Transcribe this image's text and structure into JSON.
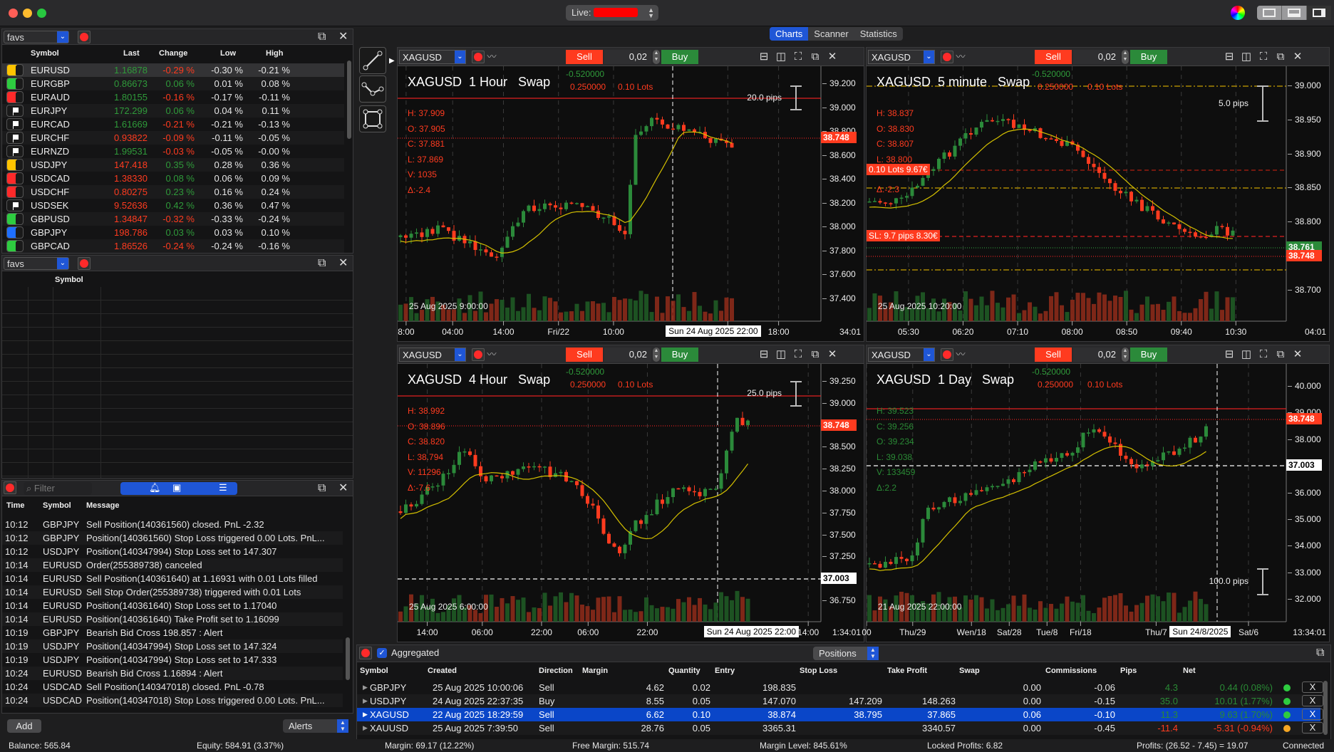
{
  "titlebar": {
    "account_label": "Live:",
    "colors": {
      "red": "#ff5f57",
      "yellow": "#febc2e",
      "green": "#28c840"
    }
  },
  "tabs": [
    {
      "label": "Charts",
      "active": true
    },
    {
      "label": "Scanner"
    },
    {
      "label": "Statistics"
    }
  ],
  "watchlist": {
    "list_name": "favs",
    "columns": [
      "Symbol",
      "Last",
      "Change",
      "Low",
      "High"
    ],
    "rows": [
      {
        "flag": "#ffc400",
        "symbol": "EURUSD",
        "last": "1.16878",
        "last_dir": "up",
        "change": "-0.29 %",
        "change_dir": "down",
        "low": "-0.30 %",
        "high": "-0.21 %"
      },
      {
        "flag": "#2ecc40",
        "symbol": "EURGBP",
        "last": "0.86673",
        "last_dir": "up",
        "change": "0.06 %",
        "change_dir": "up",
        "low": "0.01 %",
        "high": "0.08 %"
      },
      {
        "flag": "#ff2a2a",
        "symbol": "EURAUD",
        "last": "1.80155",
        "last_dir": "up",
        "change": "-0.16 %",
        "change_dir": "down",
        "low": "-0.17 %",
        "high": "-0.11 %"
      },
      {
        "flag": "white",
        "symbol": "EURJPY",
        "last": "172.299",
        "last_dir": "up",
        "change": "0.06 %",
        "change_dir": "up",
        "low": "0.04 %",
        "high": "0.11 %"
      },
      {
        "flag": "white",
        "symbol": "EURCAD",
        "last": "1.61669",
        "last_dir": "up",
        "change": "-0.21 %",
        "change_dir": "down",
        "low": "-0.21 %",
        "high": "-0.13 %"
      },
      {
        "flag": "white",
        "symbol": "EURCHF",
        "last": "0.93822",
        "last_dir": "down",
        "change": "-0.09 %",
        "change_dir": "down",
        "low": "-0.11 %",
        "high": "-0.05 %"
      },
      {
        "flag": "white",
        "symbol": "EURNZD",
        "last": "1.99531",
        "last_dir": "up",
        "change": "-0.03 %",
        "change_dir": "down",
        "low": "-0.05 %",
        "high": "-0.00 %"
      },
      {
        "flag": "#ffc400",
        "symbol": "USDJPY",
        "last": "147.418",
        "last_dir": "down",
        "change": "0.35 %",
        "change_dir": "up",
        "low": "0.28 %",
        "high": "0.36 %"
      },
      {
        "flag": "#ff2a2a",
        "symbol": "USDCAD",
        "last": "1.38330",
        "last_dir": "down",
        "change": "0.08 %",
        "change_dir": "up",
        "low": "0.06 %",
        "high": "0.09 %"
      },
      {
        "flag": "#ff2a2a",
        "symbol": "USDCHF",
        "last": "0.80275",
        "last_dir": "down",
        "change": "0.23 %",
        "change_dir": "up",
        "low": "0.16 %",
        "high": "0.24 %"
      },
      {
        "flag": "white",
        "symbol": "USDSEK",
        "last": "9.52636",
        "last_dir": "down",
        "change": "0.42 %",
        "change_dir": "up",
        "low": "0.36 %",
        "high": "0.47 %"
      },
      {
        "flag": "#2ecc40",
        "symbol": "GBPUSD",
        "last": "1.34847",
        "last_dir": "down",
        "change": "-0.32 %",
        "change_dir": "down",
        "low": "-0.33 %",
        "high": "-0.24 %"
      },
      {
        "flag": "#1f6fff",
        "symbol": "GBPJPY",
        "last": "198.786",
        "last_dir": "down",
        "change": "0.03 %",
        "change_dir": "up",
        "low": "0.03 %",
        "high": "0.10 %"
      },
      {
        "flag": "#2ecc40",
        "symbol": "GBPCAD",
        "last": "1.86526",
        "last_dir": "down",
        "change": "-0.24 %",
        "change_dir": "down",
        "low": "-0.24 %",
        "high": "-0.16 %"
      }
    ]
  },
  "watchlist2": {
    "list_name": "favs",
    "column": "Symbol"
  },
  "log": {
    "filter_placeholder": "Filter",
    "columns": [
      "Time",
      "Symbol",
      "Message"
    ],
    "rows": [
      [
        "10:12",
        "GBPJPY",
        "Sell Position(140361560) closed. PnL -2.32"
      ],
      [
        "10:12",
        "GBPJPY",
        "Position(140361560) Stop Loss triggered 0.00 Lots. PnL..."
      ],
      [
        "10:12",
        "USDJPY",
        "Position(140347994) Stop Loss set to 147.307"
      ],
      [
        "10:14",
        "EURUSD",
        "Order(255389738) canceled"
      ],
      [
        "10:14",
        "EURUSD",
        "Sell Position(140361640) at 1.16931 with 0.01 Lots filled"
      ],
      [
        "10:14",
        "EURUSD",
        "Sell  Stop Order(255389738) triggered with 0.01 Lots"
      ],
      [
        "10:14",
        "EURUSD",
        "Position(140361640) Stop Loss set to 1.17040"
      ],
      [
        "10:14",
        "EURUSD",
        "Position(140361640) Take Profit set to 1.16099"
      ],
      [
        "10:19",
        "GBPJPY",
        "Bearish Bid Cross 198.857 : Alert"
      ],
      [
        "10:19",
        "USDJPY",
        "Position(140347994) Stop Loss set to 147.324"
      ],
      [
        "10:19",
        "USDJPY",
        "Position(140347994) Stop Loss set to 147.333"
      ],
      [
        "10:24",
        "EURUSD",
        "Bearish Bid Cross 1.16894 : Alert"
      ],
      [
        "10:24",
        "USDCAD",
        "Sell Position(140347018) closed. PnL -0.78"
      ],
      [
        "10:24",
        "USDCAD",
        "Position(140347018) Stop Loss triggered 0.00 Lots. PnL..."
      ]
    ],
    "add_label": "Add",
    "mode_select": "Alerts"
  },
  "charts": [
    {
      "symbol": "XAGUSD",
      "qty": "0,02",
      "sell": "Sell",
      "buy": "Buy",
      "title": "XAGUSD  1 Hour   Swap",
      "swap_long": "-0.520000",
      "swap_short": "0.250000",
      "lots": "0.10 Lots",
      "ohlc": [
        "H: 37.909",
        "O: 37.905",
        "C: 37.881",
        "L: 37.869",
        "V: 1035",
        "Δ:-2.4"
      ],
      "ohlc_color": "red",
      "yticks": [
        "39.200",
        "39.000",
        "38.800",
        "38.600",
        "38.400",
        "38.200",
        "38.000",
        "37.800",
        "37.600",
        "37.400"
      ],
      "price_tags": [
        {
          "value": "38.748",
          "color": "#ff3b1f"
        }
      ],
      "xticks": [
        "8:00",
        "04:00",
        "14:00",
        "Fri/22",
        "10:00",
        "00",
        "18:00"
      ],
      "cursor_time": "Sun 24 Aug 2025 22:00",
      "countdown": "34:01",
      "date_label": "25 Aug 2025 9:00:00",
      "pips": "20.0 pips"
    },
    {
      "symbol": "XAGUSD",
      "qty": "0,02",
      "sell": "Sell",
      "buy": "Buy",
      "title": "XAGUSD  5 minute   Swap",
      "swap_long": "-0.520000",
      "swap_short": "0.250000",
      "lots": "0.10 Lots",
      "ohlc": [
        "H: 38.837",
        "O: 38.830",
        "C: 38.807",
        "L: 38.800",
        "Δ:-2.3"
      ],
      "ohlc_color": "red",
      "yticks": [
        "39.000",
        "38.950",
        "38.900",
        "38.850",
        "38.800",
        "38.750",
        "38.700"
      ],
      "price_tags": [
        {
          "value": "38.761",
          "color": "#2b8a3a"
        },
        {
          "value": "38.748",
          "color": "#ff3b1f"
        }
      ],
      "order_tags": [
        "0.10 Lots 9.67€",
        "SL: 9.7 pips 8.30€"
      ],
      "xticks": [
        "05:30",
        "06:20",
        "07:10",
        "08:00",
        "08:50",
        "09:40",
        "10:30"
      ],
      "countdown": "04:01",
      "date_label": "25 Aug 2025 10:20:00",
      "pips": "5.0 pips"
    },
    {
      "symbol": "XAGUSD",
      "qty": "0,02",
      "sell": "Sell",
      "buy": "Buy",
      "title": "XAGUSD  4 Hour   Swap",
      "swap_long": "-0.520000",
      "swap_short": "0.250000",
      "lots": "0.10 Lots",
      "ohlc": [
        "H: 38.992",
        "O: 38.896",
        "C: 38.820",
        "L: 38.794",
        "V: 11296",
        "Δ:-7.6"
      ],
      "ohlc_color": "red",
      "yticks": [
        "39.250",
        "39.000",
        "38.750",
        "38.500",
        "38.250",
        "38.000",
        "37.750",
        "37.500",
        "37.250",
        "37.000",
        "36.750"
      ],
      "price_tags": [
        {
          "value": "38.748",
          "color": "#ff3b1f"
        },
        {
          "value": "37.003",
          "color": "#ffffff"
        }
      ],
      "xticks": [
        "14:00",
        "06:00",
        "22:00",
        "06:00",
        "22:00",
        "14:00"
      ],
      "cursor_time": "Sun 24 Aug 2025 22:00",
      "countdown": "1:34:01",
      "date_label": "25 Aug 2025 6:00:00",
      "pips": "25.0 pips"
    },
    {
      "symbol": "XAGUSD",
      "qty": "0,02",
      "sell": "Sell",
      "buy": "Buy",
      "title": "XAGUSD  1 Day   Swap",
      "swap_long": "-0.520000",
      "swap_short": "0.250000",
      "lots": "0.10 Lots",
      "ohlc": [
        "H: 39.523",
        "C: 39.256",
        "O: 39.234",
        "L: 39.038",
        "V: 133459",
        "Δ:2.2"
      ],
      "ohlc_color": "green",
      "yticks": [
        "40.000",
        "39.000",
        "38.000",
        "37.000",
        "36.000",
        "35.000",
        "34.000",
        "33.000",
        "32.000"
      ],
      "price_tags": [
        {
          "value": "38.748",
          "color": "#ff3b1f"
        },
        {
          "value": "37.003",
          "color": "#ffffff"
        }
      ],
      "xticks": [
        "00",
        "Thu/29",
        "Wen/18",
        "Sat/28",
        "Tue/8",
        "Fri/18",
        "Thu/7",
        "Sat/6"
      ],
      "cursor_time": "Sun 24/8/2025",
      "countdown": "13:34:01",
      "date_label": "21 Aug 2025 22:00:00",
      "pips": "100.0 pips"
    }
  ],
  "positions": {
    "aggregated_label": "Aggregated",
    "view_select": "Positions",
    "columns": [
      "Symbol",
      "Created",
      "Direction",
      "Margin",
      "Quantity",
      "Entry",
      "Stop Loss",
      "Take Profit",
      "Swap",
      "Commissions",
      "Pips",
      "Net"
    ],
    "rows": [
      {
        "symbol": "GBPJPY",
        "created": "25 Aug 2025 10:00:06",
        "direction": "Sell",
        "margin": "4.62",
        "quantity": "0.02",
        "entry": "198.835",
        "stop_loss": "",
        "take_profit": "",
        "swap": "0.00",
        "commissions": "-0.06",
        "pips": "4.3",
        "net": "0.44 (0.08%)",
        "status": "#2ecc40",
        "selected": false
      },
      {
        "symbol": "USDJPY",
        "created": "24 Aug 2025 22:37:35",
        "direction": "Buy",
        "margin": "8.55",
        "quantity": "0.05",
        "entry": "147.070",
        "stop_loss": "147.209",
        "take_profit": "148.263",
        "swap": "0.00",
        "commissions": "-0.15",
        "pips": "35.0",
        "net": "10.01 (1.77%)",
        "status": "#2ecc40",
        "selected": false
      },
      {
        "symbol": "XAGUSD",
        "created": "22 Aug 2025 18:29:59",
        "direction": "Sell",
        "margin": "6.62",
        "quantity": "0.10",
        "entry": "38.874",
        "stop_loss": "38.795",
        "take_profit": "37.865",
        "swap": "0.06",
        "commissions": "-0.10",
        "pips": "11.3",
        "net": "9.63 (1.70%)",
        "status": "#2ecc40",
        "selected": true
      },
      {
        "symbol": "XAUUSD",
        "created": "25 Aug 2025 7:39:50",
        "direction": "Sell",
        "margin": "28.76",
        "quantity": "0.05",
        "entry": "3365.31",
        "stop_loss": "",
        "take_profit": "3340.57",
        "swap": "0.00",
        "commissions": "-0.45",
        "pips": "-11.4",
        "net": "-5.31 (-0.94%)",
        "status": "#f5a623",
        "selected": false
      }
    ],
    "close_label": "X"
  },
  "status": {
    "balance": "Balance: 565.84",
    "equity": "Equity: 584.91 (3.37%)",
    "margin": "Margin: 69.17 (12.22%)",
    "free_margin": "Free Margin: 515.74",
    "margin_level": "Margin Level: 845.61%",
    "locked_profits": "Locked Profits: 6.82",
    "profits": "Profits: (26.52 - 7.45) = 19.07",
    "connection": "Connected"
  }
}
